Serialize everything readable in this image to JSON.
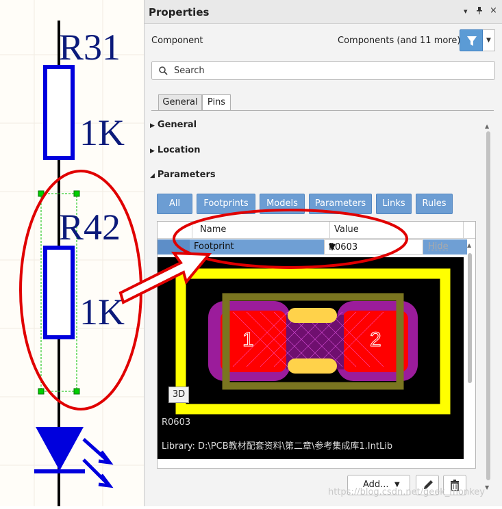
{
  "schematic": {
    "designators": [
      "R31",
      "R42"
    ],
    "values": [
      "1K",
      "1K"
    ]
  },
  "panel": {
    "title": "Properties",
    "titlebar_icons": [
      "chevron-down-icon",
      "pin-icon",
      "close-icon"
    ],
    "component_label": "Component",
    "component_scope": "Components (and 11 more)",
    "search_placeholder": "Search",
    "tabs": [
      "General",
      "Pins"
    ],
    "active_tab": "Pins",
    "sections": [
      {
        "label": "General",
        "expanded": false
      },
      {
        "label": "Location",
        "expanded": false
      },
      {
        "label": "Parameters",
        "expanded": true
      }
    ],
    "filter_buttons": [
      "All",
      "Footprints",
      "Models",
      "Parameters",
      "Links",
      "Rules"
    ],
    "grid": {
      "columns": [
        "Name",
        "Value"
      ],
      "row": {
        "name": "Footprint",
        "value": "R0603",
        "hide_label": "Hide"
      }
    },
    "preview": {
      "button_3d": "3D",
      "pad_labels": [
        "1",
        "2"
      ],
      "footprint_name": "R0603",
      "library_text": "Library: D:\\PCB教材配套资料\\第二章\\参考集成库1.IntLib"
    },
    "add_button": "Add...",
    "watermark": "https://blog.csdn.net/geek_monkey"
  },
  "colors": {
    "accent": "#5b9bd5",
    "filter_button": "#6c9dd3",
    "selected_row": "#6f9fd4",
    "annotation": "#e00000",
    "schematic_blue": "#0000cc",
    "footprint_yellow": "#ffff00",
    "pad_red": "#ff0000"
  }
}
